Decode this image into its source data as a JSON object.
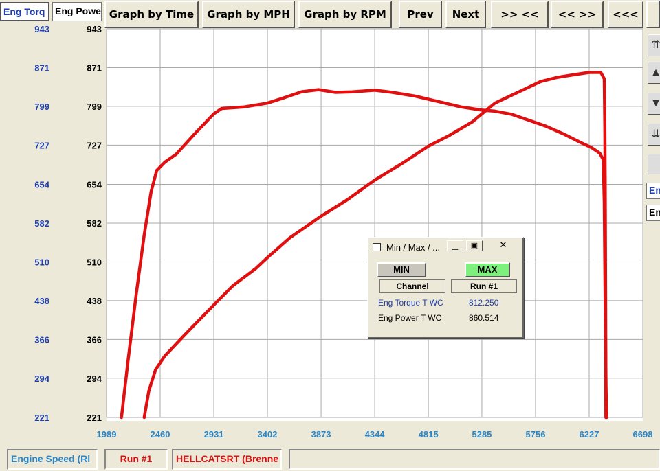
{
  "tabs": [
    "Eng Torq",
    "Eng Powe"
  ],
  "toolbar": {
    "graph_by_time": "Graph by Time",
    "graph_by_mph": "Graph by MPH",
    "graph_by_rpm": "Graph by RPM",
    "prev": "Prev",
    "next": "Next",
    "zoom_in": ">> <<",
    "zoom_out": "<< >>",
    "pan_left": "<<<"
  },
  "right_labels": [
    "En",
    "En"
  ],
  "status": {
    "axis": "Engine Speed (Rl",
    "run": "Run #1",
    "vehicle": "HELLCATSRT (Brenne"
  },
  "dialog": {
    "title": "Min / Max / ...",
    "min_label": "MIN",
    "max_label": "MAX",
    "col_channel": "Channel",
    "col_run": "Run #1",
    "rows": [
      {
        "channel": "Eng Torque T WC",
        "value": "812.250"
      },
      {
        "channel": "Eng Power T WC",
        "value": "860.514"
      }
    ]
  },
  "chart_data": {
    "type": "line",
    "xlabel": "",
    "ylabel": "",
    "x_ticks": [
      "1989",
      "2460",
      "2931",
      "3402",
      "3873",
      "4344",
      "4815",
      "5285",
      "5756",
      "6227",
      "6698"
    ],
    "y_ticks_left": [
      "943",
      "871",
      "799",
      "727",
      "654",
      "582",
      "510",
      "438",
      "366",
      "294",
      "221"
    ],
    "y_ticks_right": [
      "943",
      "871",
      "799",
      "727",
      "654",
      "582",
      "510",
      "438",
      "366",
      "294",
      "221"
    ],
    "xlim": [
      1989,
      6698
    ],
    "ylim": [
      221,
      943
    ],
    "grid": true,
    "line_color": "#e01010",
    "series": [
      {
        "channel": "Eng Torque T WC",
        "points": [
          [
            2120,
            221
          ],
          [
            2180,
            330
          ],
          [
            2250,
            450
          ],
          [
            2320,
            560
          ],
          [
            2380,
            640
          ],
          [
            2430,
            680
          ],
          [
            2500,
            695
          ],
          [
            2600,
            710
          ],
          [
            2750,
            745
          ],
          [
            2930,
            785
          ],
          [
            3000,
            795
          ],
          [
            3200,
            798
          ],
          [
            3402,
            805
          ],
          [
            3550,
            815
          ],
          [
            3700,
            826
          ],
          [
            3850,
            830
          ],
          [
            4000,
            825
          ],
          [
            4150,
            826
          ],
          [
            4344,
            829
          ],
          [
            4500,
            825
          ],
          [
            4700,
            818
          ],
          [
            4900,
            808
          ],
          [
            5100,
            798
          ],
          [
            5285,
            792
          ],
          [
            5400,
            790
          ],
          [
            5550,
            784
          ],
          [
            5700,
            773
          ],
          [
            5850,
            762
          ],
          [
            6000,
            748
          ],
          [
            6150,
            732
          ],
          [
            6250,
            722
          ],
          [
            6320,
            712
          ],
          [
            6350,
            700
          ],
          [
            6360,
            620
          ],
          [
            6365,
            500
          ],
          [
            6370,
            380
          ],
          [
            6375,
            280
          ],
          [
            6380,
            221
          ]
        ]
      },
      {
        "channel": "Eng Power T WC",
        "points": [
          [
            2320,
            221
          ],
          [
            2360,
            270
          ],
          [
            2420,
            310
          ],
          [
            2500,
            335
          ],
          [
            2700,
            380
          ],
          [
            2931,
            430
          ],
          [
            3100,
            466
          ],
          [
            3300,
            498
          ],
          [
            3402,
            518
          ],
          [
            3600,
            555
          ],
          [
            3873,
            595
          ],
          [
            4100,
            625
          ],
          [
            4344,
            662
          ],
          [
            4600,
            695
          ],
          [
            4815,
            725
          ],
          [
            5000,
            745
          ],
          [
            5200,
            770
          ],
          [
            5285,
            785
          ],
          [
            5400,
            805
          ],
          [
            5500,
            815
          ],
          [
            5650,
            830
          ],
          [
            5800,
            845
          ],
          [
            5950,
            853
          ],
          [
            6100,
            858
          ],
          [
            6227,
            862
          ],
          [
            6330,
            862
          ],
          [
            6360,
            850
          ],
          [
            6365,
            760
          ],
          [
            6368,
            650
          ],
          [
            6370,
            520
          ],
          [
            6372,
            400
          ],
          [
            6373,
            300
          ],
          [
            6374,
            221
          ]
        ]
      }
    ]
  }
}
